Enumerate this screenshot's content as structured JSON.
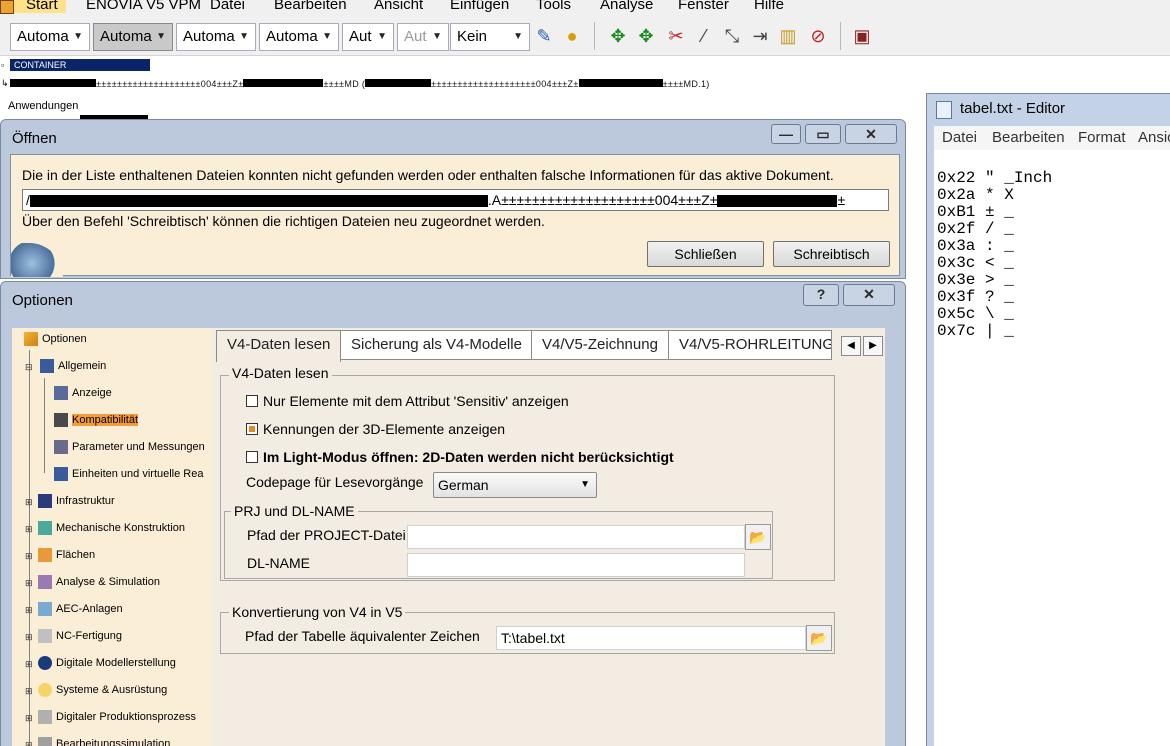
{
  "menubar": {
    "items": [
      "Start",
      "ENOVIA V5 VPM",
      "Datei",
      "Bearbeiten",
      "Ansicht",
      "Einfügen",
      "Tools",
      "Analyse",
      "Fenster",
      "Hilfe"
    ]
  },
  "toolbar": {
    "combos": [
      "Automa",
      "Automa",
      "Automa",
      "Automa",
      "Aut",
      "Aut",
      "Kein"
    ]
  },
  "tree": {
    "container": "CONTAINER",
    "path_line": "±±±±±±±±±±±±±±±±±±±±004±±±Z±",
    "path_line_2": "±±±±MD (",
    "path_line_3": "±±±±±±±±±±±±±±±±±±±±004±±±Z±",
    "path_line_4": "±±±±MD.1)",
    "apps": "Anwendungen"
  },
  "open_dialog": {
    "title": "Öffnen",
    "message": "Die in der Liste enthaltenen Dateien konnten nicht gefunden werden oder enthalten falsche Informationen für das aktive Dokument.",
    "path_prefix": "/",
    "path_mid": ".A±±±±±±±±±±±±±±±±±±±±004±±±Z±",
    "path_end": "±",
    "note": "Über den Befehl 'Schreibtisch' können die richtigen Dateien neu zugeordnet werden.",
    "close_button": "Schließen",
    "desk_button": "Schreibtisch"
  },
  "options_dialog": {
    "title": "Optionen",
    "help": "?",
    "close": "✕",
    "tree": [
      "Optionen",
      "Allgemein",
      "Anzeige",
      "Kompatibilität",
      "Parameter und Messungen",
      "Einheiten und virtuelle Rea",
      "Infrastruktur",
      "Mechanische Konstruktion",
      "Flächen",
      "Analyse & Simulation",
      "AEC-Anlagen",
      "NC-Fertigung",
      "Digitale Modellerstellung",
      "Systeme & Ausrüstung",
      "Digitaler Produktionsprozess",
      "Bearbeitungssimulation"
    ],
    "tabs": [
      "V4-Daten lesen",
      "Sicherung als V4-Modelle",
      "V4/V5-Zeichnung",
      "V4/V5-ROHRLEITUNG"
    ],
    "group_read": {
      "label": "V4-Daten lesen",
      "cb1": "Nur Elemente mit dem Attribut 'Sensitiv' anzeigen",
      "cb1_checked": false,
      "cb2": "Kennungen der 3D-Elemente anzeigen",
      "cb2_checked": true,
      "cb3": "Im Light-Modus öffnen: 2D-Daten werden nicht berücksichtigt",
      "cb3_checked": false,
      "codepage_label": "Codepage für Lesevorgänge",
      "codepage_value": "German"
    },
    "group_prj": {
      "label": "PRJ und DL-NAME",
      "project_label": "Pfad der PROJECT-Datei",
      "project_value": "",
      "dlname_label": "DL-NAME",
      "dlname_value": ""
    },
    "group_conv": {
      "label": "Konvertierung von V4 in V5",
      "table_label": "Pfad der Tabelle äquivalenter Zeichen",
      "table_value": "T:\\tabel.txt"
    }
  },
  "editor": {
    "title": "tabel.txt - Editor",
    "menu": [
      "Datei",
      "Bearbeiten",
      "Format",
      "Ansic"
    ],
    "lines": [
      "0x22 \" _Inch",
      "0x2a * X",
      "0xB1 ± _",
      "0x2f / _",
      "0x3a : _",
      "0x3c < _",
      "0x3e > _",
      "0x3f ? _",
      "0x5c \\ _",
      "0x7c | _"
    ]
  }
}
